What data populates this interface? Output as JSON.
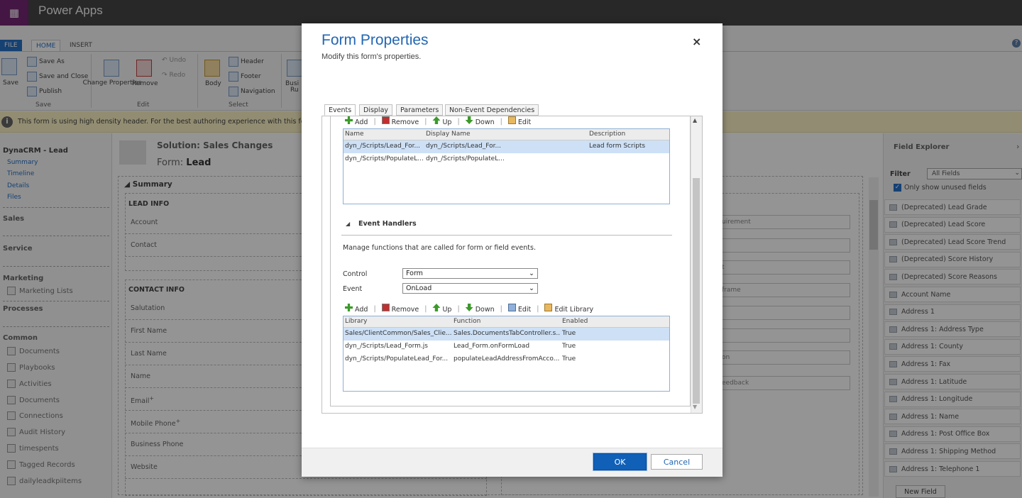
{
  "app": {
    "title": "Power Apps"
  },
  "ribbon": {
    "tabs": {
      "file": "FILE",
      "home": "HOME",
      "insert": "INSERT"
    },
    "save": "Save",
    "save_as": "Save As",
    "save_and_close": "Save and Close",
    "publish": "Publish",
    "change_properties": "Change Properties",
    "remove": "Remove",
    "undo": "Undo",
    "redo": "Redo",
    "body": "Body",
    "header": "Header",
    "footer": "Footer",
    "navigation": "Navigation",
    "business_rules_partial": "Busi",
    "business_rules_partial2": "Ru",
    "group_save": "Save",
    "group_edit": "Edit",
    "group_select": "Select",
    "help_icon": "?"
  },
  "notice": {
    "text": "This form is using high density header. For the best authoring experience with this form, us"
  },
  "leftnav": {
    "entity": "DynaCRM - Lead",
    "subs": [
      "Summary",
      "Timeline",
      "Details",
      "Files"
    ],
    "sections": {
      "sales": "Sales",
      "service": "Service",
      "marketing": "Marketing",
      "processes": "Processes",
      "common": "Common"
    },
    "marketing_items": [
      "Marketing Lists"
    ],
    "common_items": [
      "Documents",
      "Playbooks",
      "Activities",
      "Documents",
      "Connections",
      "Audit History",
      "timespents",
      "Tagged Records",
      "dailyleadkpiitems"
    ]
  },
  "form": {
    "solution": "Solution: Sales Changes",
    "form_label": "Form:",
    "form_name": "Lead",
    "tab_summary": "Summary",
    "section_lead_info": "LEAD INFO",
    "section_contact_info": "CONTACT INFO",
    "fields": [
      "Account",
      "Contact",
      "Salutation",
      "First Name",
      "Last Name",
      "Name",
      "Email",
      "Mobile Phone",
      "Business Phone",
      "Website"
    ],
    "required_mark": "+",
    "right_fields": [
      "uirement",
      "t",
      "frame",
      "on",
      "eedback"
    ]
  },
  "field_explorer": {
    "title": "Field Explorer",
    "filter_label": "Filter",
    "filter_value": "All Fields",
    "only_unused": "Only show unused fields",
    "items": [
      "(Deprecated) Lead Grade",
      "(Deprecated) Lead Score",
      "(Deprecated) Lead Score Trend",
      "(Deprecated) Score History",
      "(Deprecated) Score Reasons",
      "Account Name",
      "Address 1",
      "Address 1: Address Type",
      "Address 1: County",
      "Address 1: Fax",
      "Address 1: Latitude",
      "Address 1: Longitude",
      "Address 1: Name",
      "Address 1: Post Office Box",
      "Address 1: Shipping Method",
      "Address 1: Telephone 1"
    ],
    "new_field": "New Field"
  },
  "dialog": {
    "title": "Form Properties",
    "subtitle": "Modify this form's properties.",
    "close": "×",
    "tabs": [
      "Events",
      "Display",
      "Parameters",
      "Non-Event Dependencies"
    ],
    "lib_toolbar": {
      "add": "Add",
      "remove": "Remove",
      "up": "Up",
      "down": "Down",
      "edit": "Edit"
    },
    "lib_columns": [
      "Name",
      "Display Name",
      "Description"
    ],
    "lib_rows": [
      [
        "dyn_/Scripts/Lead_For...",
        "dyn_/Scripts/Lead_For...",
        "Lead form Scripts"
      ],
      [
        "dyn_/Scripts/PopulateL...",
        "dyn_/Scripts/PopulateL...",
        ""
      ]
    ],
    "event_handlers": "Event Handlers",
    "eh_desc": "Manage functions that are called for form or field events.",
    "control_label": "Control",
    "control_value": "Form",
    "event_label": "Event",
    "event_value": "OnLoad",
    "eh_toolbar": {
      "add": "Add",
      "remove": "Remove",
      "up": "Up",
      "down": "Down",
      "edit": "Edit",
      "edit_library": "Edit Library"
    },
    "eh_columns": [
      "Library",
      "Function",
      "Enabled"
    ],
    "eh_rows": [
      [
        "Sales/ClientCommon/Sales_Clie...",
        "Sales.DocumentsTabController.s...",
        "True"
      ],
      [
        "dyn_/Scripts/Lead_Form.js",
        "Lead_Form.onFormLoad",
        "True"
      ],
      [
        "dyn_/Scripts/PopulateLead_For...",
        "populateLeadAddressFromAcco...",
        "True"
      ]
    ],
    "ok": "OK",
    "cancel": "Cancel"
  }
}
